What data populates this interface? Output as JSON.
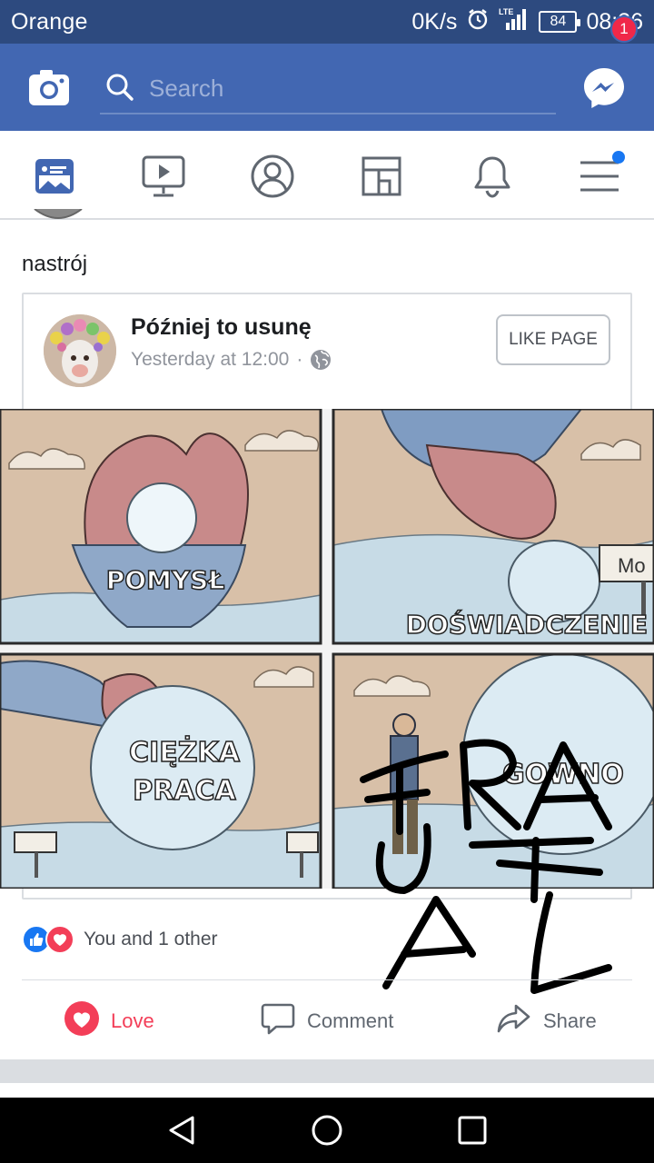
{
  "status_bar": {
    "carrier": "Orange",
    "speed": "0K/s",
    "network": "LTE",
    "battery": "84",
    "time": "08:36"
  },
  "header": {
    "search_placeholder": "Search",
    "messenger_badge": "1"
  },
  "nav": {
    "tabs": [
      "news-feed",
      "watch",
      "profile",
      "marketplace",
      "notifications",
      "menu"
    ]
  },
  "post": {
    "text": "nastrój",
    "shared": {
      "page_name": "Później to usunę",
      "timestamp": "Yesterday at 12:00",
      "separator": "·",
      "like_page_label": "LIKE PAGE"
    },
    "meme": {
      "panel_1": "POMYSŁ",
      "panel_2": "DOŚWIADCZENIE",
      "panel_2_sign": "Mo",
      "panel_3_line1": "CIĘŻKA",
      "panel_3_line2": "PRACA",
      "panel_4": "GOWNO",
      "scribble": "FRAUTAL"
    },
    "reactions_text": "You and 1 other",
    "actions": {
      "love": "Love",
      "comment": "Comment",
      "share": "Share"
    }
  },
  "colors": {
    "facebook_blue": "#4267b2",
    "status_bar": "#2d4a7f",
    "love_red": "#f33e58",
    "like_blue": "#1877f2"
  }
}
